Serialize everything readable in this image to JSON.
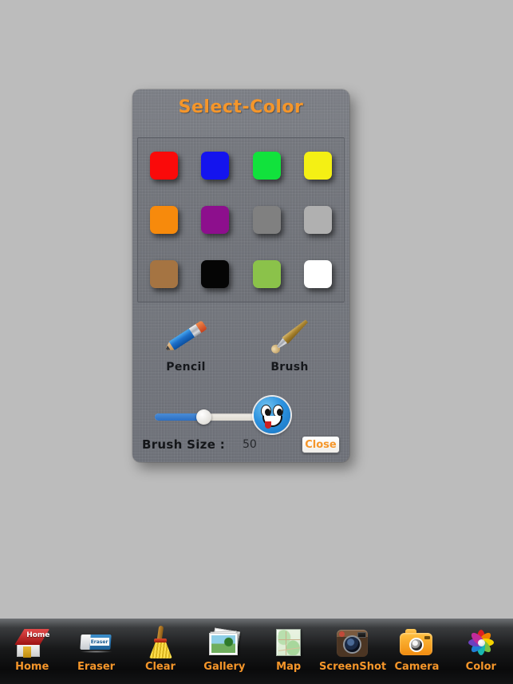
{
  "dialog": {
    "title": "Select-Color",
    "title_color": "#f5962a",
    "background_color": "#75787f",
    "colors": [
      {
        "name": "red",
        "hex": "#fa0a0a"
      },
      {
        "name": "blue",
        "hex": "#1414ee"
      },
      {
        "name": "green",
        "hex": "#11e23c"
      },
      {
        "name": "yellow",
        "hex": "#f4f014"
      },
      {
        "name": "orange",
        "hex": "#f78a0c"
      },
      {
        "name": "purple",
        "hex": "#8d0f8d"
      },
      {
        "name": "dark-gray",
        "hex": "#808080"
      },
      {
        "name": "light-gray",
        "hex": "#b0b0b0"
      },
      {
        "name": "brown",
        "hex": "#a57442"
      },
      {
        "name": "black",
        "hex": "#050505"
      },
      {
        "name": "olive-green",
        "hex": "#8bc24a"
      },
      {
        "name": "white",
        "hex": "#ffffff"
      }
    ],
    "tools": [
      {
        "id": "pencil",
        "label": "Pencil"
      },
      {
        "id": "brush",
        "label": "Brush"
      }
    ],
    "slider": {
      "value": 50,
      "min": 0,
      "max": 100,
      "fill_percent": 45,
      "fill_color": "#2b6fc4",
      "track_color": "#efece6"
    },
    "brush_size": {
      "label": "Brush Size :",
      "value": "50"
    },
    "preview": {
      "name": "blue-smiley-face",
      "color": "#2d92df"
    },
    "close_button": {
      "label": "Close",
      "text_color": "#f5962a"
    }
  },
  "toolbar": {
    "background": "#111213",
    "label_color": "#f5962a",
    "items": [
      {
        "id": "home",
        "label": "Home",
        "icon": "house-icon"
      },
      {
        "id": "eraser",
        "label": "Eraser",
        "icon": "eraser-icon",
        "chip_text": "Eraser"
      },
      {
        "id": "clear",
        "label": "Clear",
        "icon": "broom-icon"
      },
      {
        "id": "gallery",
        "label": "Gallery",
        "icon": "photo-stack-icon"
      },
      {
        "id": "map",
        "label": "Map",
        "icon": "map-icon"
      },
      {
        "id": "screenshot",
        "label": "ScreenShot",
        "icon": "vintage-camera-icon"
      },
      {
        "id": "camera",
        "label": "Camera",
        "icon": "camera-icon"
      },
      {
        "id": "color",
        "label": "Color",
        "icon": "color-pinwheel-icon"
      }
    ]
  },
  "canvas": {
    "background_color": "#bcbcbc"
  },
  "home_icon_text": "Home",
  "pinwheel_petals": [
    "#e02020",
    "#f08000",
    "#f5d400",
    "#7ac143",
    "#18b8b0",
    "#1f7fd6",
    "#6c3fbf",
    "#c02b9a"
  ]
}
